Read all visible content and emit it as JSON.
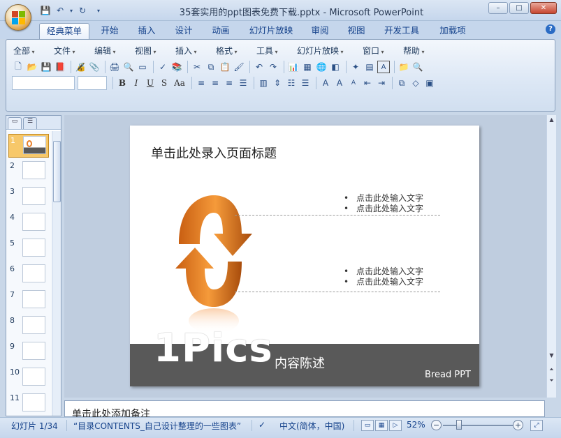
{
  "window": {
    "title": "35套实用的ppt图表免费下载.pptx - Microsoft PowerPoint",
    "controls": [
      "–",
      "□",
      "✕"
    ]
  },
  "qat": [
    "💾",
    "↶",
    "▾",
    "↻",
    "▾"
  ],
  "tabs": [
    "经典菜单",
    "开始",
    "插入",
    "设计",
    "动画",
    "幻灯片放映",
    "审阅",
    "视图",
    "开发工具",
    "加载项"
  ],
  "menu": [
    "全部",
    "文件",
    "编辑",
    "视图",
    "插入",
    "格式",
    "工具",
    "幻灯片放映",
    "窗口",
    "帮助"
  ],
  "format_buttons": [
    "B",
    "I",
    "U",
    "S",
    "Aa"
  ],
  "slides": [
    "1",
    "2",
    "3",
    "4",
    "5",
    "6",
    "7",
    "8",
    "9",
    "10",
    "11"
  ],
  "slide": {
    "title": "单击此处录入页面标题",
    "bullets_top": [
      "点击此处输入文字",
      "点击此处输入文字"
    ],
    "bullets_bottom": [
      "点击此处输入文字",
      "点击此处输入文字"
    ],
    "big_text": "1Pics",
    "content_desc": "内容陈述",
    "brand": "Bread  PPT"
  },
  "notes": "单击此处添加备注",
  "status": {
    "slide_count": "幻灯片 1/34",
    "theme": "“目录CONTENTS_自己设计整理的一些图表”",
    "language": "中文(简体，中国)",
    "zoom": "52%"
  },
  "colors": {
    "accent_orange": "#e8802b",
    "band_gray": "#595959"
  }
}
